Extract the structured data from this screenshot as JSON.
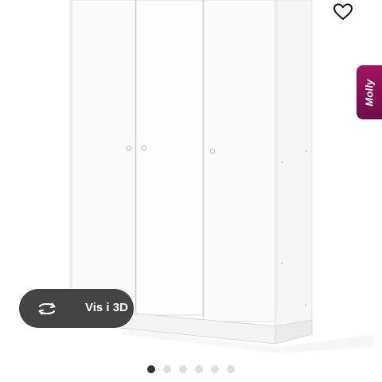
{
  "product": {
    "image_label": "",
    "favorite_icon": "heart-outline-icon"
  },
  "side_tab": {
    "label": "Molly",
    "color_top": "#a4125c",
    "color_bottom": "#6e0f4a"
  },
  "view_3d": {
    "label": "Vis i 3D",
    "icon": "rotate-3d-icon"
  },
  "gallery": {
    "dots": [
      {
        "active": true
      },
      {
        "active": false
      },
      {
        "active": false
      },
      {
        "active": false
      },
      {
        "active": false
      },
      {
        "active": false
      }
    ]
  }
}
